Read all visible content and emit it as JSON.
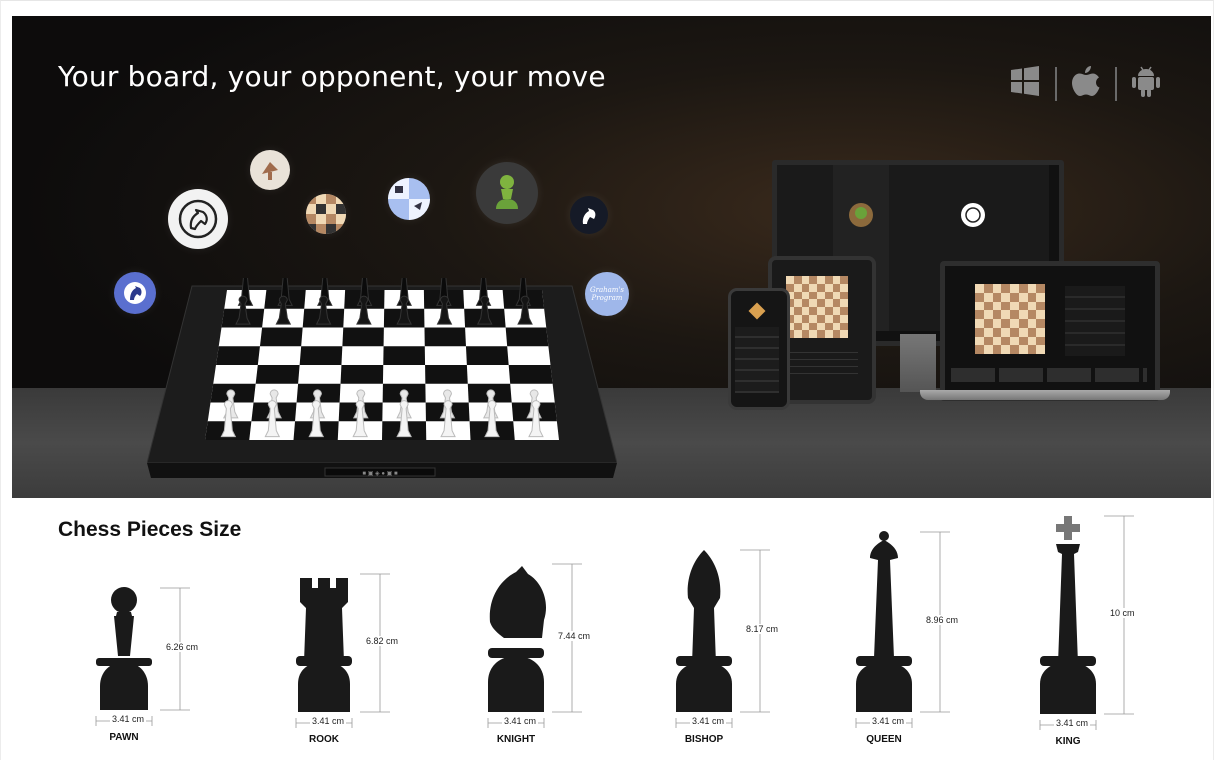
{
  "hero": {
    "title": "Your board, your opponent, your move",
    "os_icons": [
      "windows-icon",
      "apple-icon",
      "android-icon"
    ],
    "app_bubbles": [
      "lichess-icon",
      "chess-com-icon",
      "satellite-dish-icon",
      "board-pieces-icon",
      "knight-icon",
      "bot-icon",
      "pawn-icon",
      "graham-program-icon"
    ],
    "bubble_text": "Graham's Program"
  },
  "sizes": {
    "title": "Chess Pieces Size",
    "base_label": "3.41 cm",
    "pieces": [
      {
        "name": "PAWN",
        "height": "6.26 cm"
      },
      {
        "name": "ROOK",
        "height": "6.82 cm"
      },
      {
        "name": "KNIGHT",
        "height": "7.44 cm"
      },
      {
        "name": "BISHOP",
        "height": "8.17 cm"
      },
      {
        "name": "QUEEN",
        "height": "8.96 cm"
      },
      {
        "name": "KING",
        "height": "10 cm"
      }
    ]
  },
  "colors": {
    "hero_bg": "#0e0d0d",
    "board_light": "#ffffff",
    "board_dark": "#111111",
    "bubble_blue": "#8fa8e8",
    "chess_green": "#6aa23a"
  }
}
